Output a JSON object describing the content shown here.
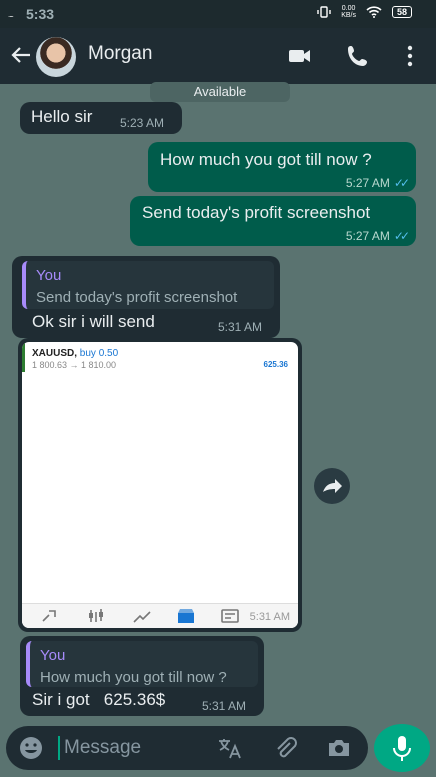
{
  "status": {
    "time": "5:33",
    "signal": "....",
    "net_speed_value": "0.00",
    "net_speed_unit": "KB/s",
    "battery": "58"
  },
  "header": {
    "contact_name": "Morgan"
  },
  "day_chip": "Available",
  "messages": [
    {
      "text": "Hello sir",
      "time": "5:23 AM"
    },
    {
      "text": "How much you got till now ?",
      "time": "5:27 AM"
    },
    {
      "text": "Send today's profit screenshot",
      "time": "5:27 AM"
    },
    {
      "quote_author": "You",
      "quote_text": "Send today's profit screenshot",
      "text": "Ok sir i will send",
      "time": "5:31 AM"
    },
    {
      "quote_author": "You",
      "quote_text": "How much you got till now ?",
      "text": "Sir i got   625.36$",
      "time": "5:31 AM"
    }
  ],
  "screenshot": {
    "symbol": "XAUUSD,",
    "side": "buy 0.50",
    "range": "1 800.63 → 1 810.00",
    "profit": "625.36",
    "time": "5:31 AM"
  },
  "composer": {
    "placeholder": "Message"
  }
}
